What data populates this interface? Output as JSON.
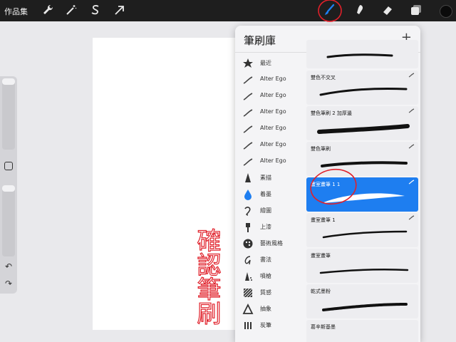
{
  "topbar": {
    "gallery_label": "作品集",
    "tools": [
      "wrench-icon",
      "magic-wand-icon",
      "selection-icon",
      "transform-arrow-icon",
      "brush-icon",
      "smudge-icon",
      "eraser-icon",
      "layers-icon"
    ],
    "active_tool": "brush-icon",
    "current_color": "#0b0b0b"
  },
  "panel": {
    "title": "筆刷庫",
    "add_label": "+",
    "sets": [
      {
        "label": "最近",
        "icon": "star-icon"
      },
      {
        "label": "Alter Ego",
        "icon": "stroke-icon"
      },
      {
        "label": "Alter Ego",
        "icon": "stroke-icon"
      },
      {
        "label": "Alter Ego",
        "icon": "stroke-icon"
      },
      {
        "label": "Alter Ego",
        "icon": "stroke-icon"
      },
      {
        "label": "Alter Ego",
        "icon": "stroke-icon"
      },
      {
        "label": "Alter Ego",
        "icon": "stroke-icon"
      },
      {
        "label": "素描",
        "icon": "pencil-nib-icon"
      },
      {
        "label": "着墨",
        "icon": "ink-drop-icon"
      },
      {
        "label": "繪圖",
        "icon": "curve-icon"
      },
      {
        "label": "上漆",
        "icon": "paint-brush-icon"
      },
      {
        "label": "藝術風格",
        "icon": "palette-icon"
      },
      {
        "label": "書法",
        "icon": "calligraphy-icon"
      },
      {
        "label": "噴槍",
        "icon": "airbrush-icon"
      },
      {
        "label": "質感",
        "icon": "texture-icon"
      },
      {
        "label": "抽象",
        "icon": "triangle-icon"
      },
      {
        "label": "炭筆",
        "icon": "charcoal-icon"
      }
    ],
    "brushes": [
      {
        "name": ""
      },
      {
        "name": "雙色不交叉"
      },
      {
        "name": "雙色筆刷 2 加厚邊"
      },
      {
        "name": "雙色筆刷"
      },
      {
        "name": "畫室畫筆 1 1",
        "selected": true
      },
      {
        "name": "畫室畫筆 1"
      },
      {
        "name": "畫室畫筆"
      },
      {
        "name": "乾式墨粉"
      },
      {
        "name": "葛辛斯基墨"
      }
    ]
  },
  "annotation": {
    "handwriting": "確認筆刷",
    "color": "#e0202a"
  },
  "colors": {
    "accent": "#1e7ef0",
    "topbar": "#1e1e1e"
  }
}
